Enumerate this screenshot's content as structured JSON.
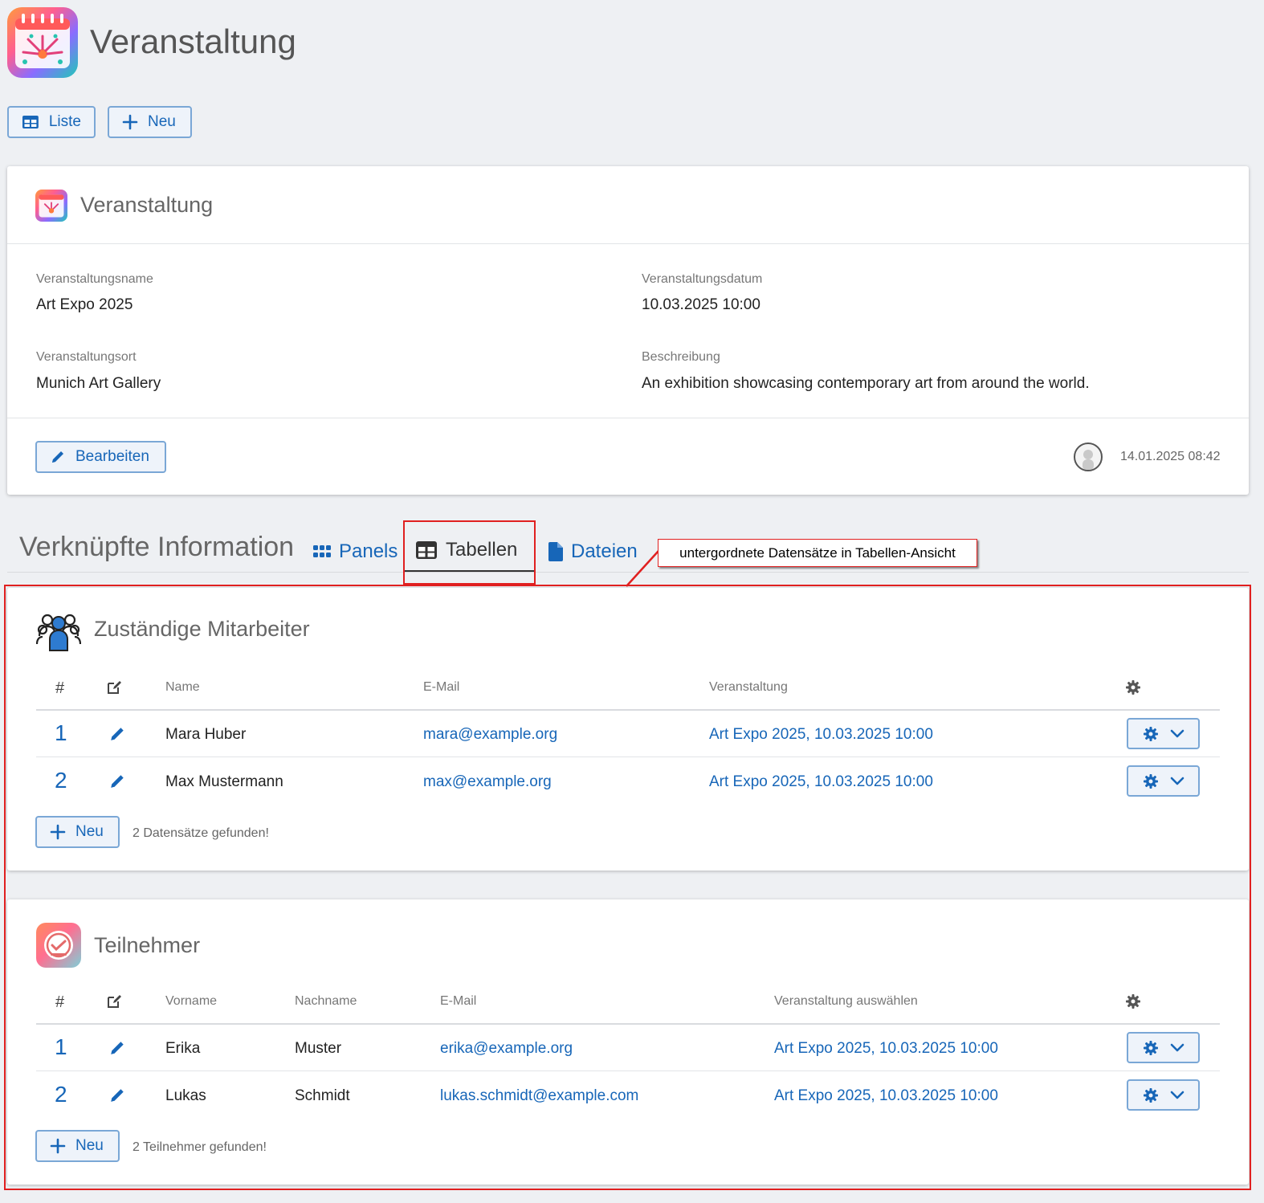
{
  "app": {
    "title": "Veranstaltung"
  },
  "toolbar": {
    "list_label": "Liste",
    "new_label": "Neu"
  },
  "record": {
    "card_title": "Veranstaltung",
    "fields": {
      "name_label": "Veranstaltungsname",
      "name_value": "Art Expo 2025",
      "date_label": "Veranstaltungsdatum",
      "date_value": "10.03.2025 10:00",
      "place_label": "Veranstaltungsort",
      "place_value": "Munich Art Gallery",
      "desc_label": "Beschreibung",
      "desc_value": "An exhibition showcasing contemporary art from around the world."
    },
    "edit_label": "Bearbeiten",
    "timestamp": "14.01.2025 08:42"
  },
  "linked": {
    "title": "Verknüpfte Information",
    "tabs": [
      {
        "label": "Panels"
      },
      {
        "label": "Tabellen"
      },
      {
        "label": "Dateien"
      }
    ],
    "annotation": "untergordnete Datensätze in Tabellen-Ansicht"
  },
  "employees": {
    "title": "Zuständige Mitarbeiter",
    "headers": {
      "num": "#",
      "name": "Name",
      "email": "E-Mail",
      "event": "Veranstaltung"
    },
    "rows": [
      {
        "num": "1",
        "name": "Mara Huber",
        "email": "mara@example.org",
        "event": "Art Expo 2025, 10.03.2025 10:00"
      },
      {
        "num": "2",
        "name": "Max Mustermann",
        "email": "max@example.org",
        "event": "Art Expo 2025, 10.03.2025 10:00"
      }
    ],
    "new_label": "Neu",
    "count_text": "2 Datensätze gefunden!"
  },
  "participants": {
    "title": "Teilnehmer",
    "headers": {
      "num": "#",
      "first": "Vorname",
      "last": "Nachname",
      "email": "E-Mail",
      "event": "Veranstaltung auswählen"
    },
    "rows": [
      {
        "num": "1",
        "first": "Erika",
        "last": "Muster",
        "email": "erika@example.org",
        "event": "Art Expo 2025, 10.03.2025 10:00"
      },
      {
        "num": "2",
        "first": "Lukas",
        "last": "Schmidt",
        "email": "lukas.schmidt@example.com",
        "event": "Art Expo 2025, 10.03.2025 10:00"
      }
    ],
    "new_label": "Neu",
    "count_text": "2 Teilnehmer gefunden!"
  },
  "colors": {
    "accent": "#1766b8",
    "highlight": "#e02020",
    "background": "#eef0f3"
  }
}
